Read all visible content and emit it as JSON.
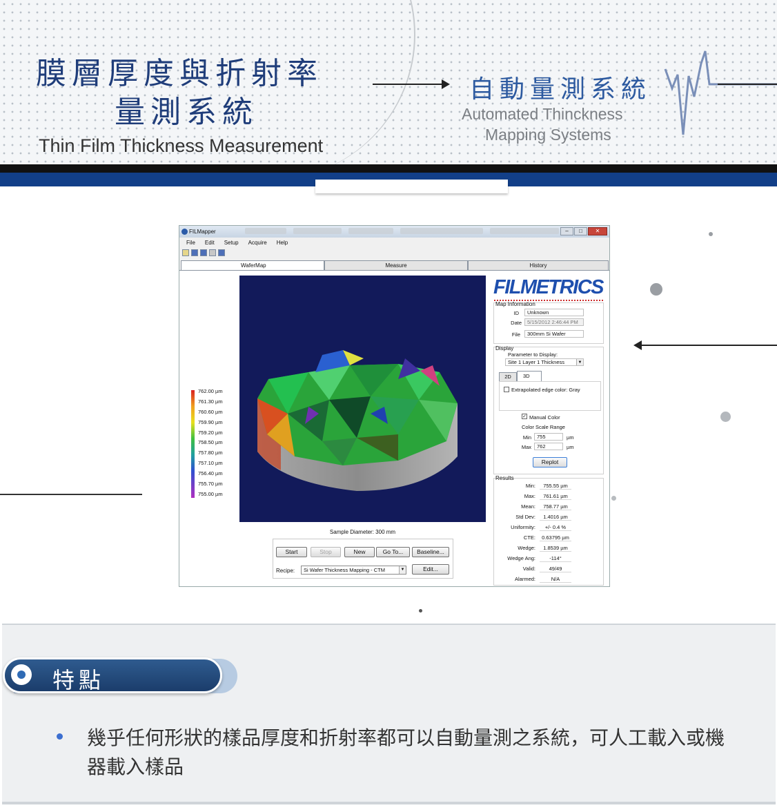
{
  "header": {
    "title_cn_line1": "膜層厚度與折射率",
    "title_cn_line2": "量測系統",
    "title_en": "Thin Film Thickness Measurement",
    "subtitle_cn": "自動量測系統",
    "subtitle_en_line1": "Automated Thinckness",
    "subtitle_en_line2": "Mapping Systems"
  },
  "app": {
    "window_title": "FILMapper",
    "window_controls": [
      "–",
      "□",
      "✕"
    ],
    "menu": [
      "File",
      "Edit",
      "Setup",
      "Acquire",
      "Help"
    ],
    "tabs": [
      "WaferMap",
      "Measure",
      "History"
    ],
    "legend_labels": [
      "762.00 µm",
      "761.30 µm",
      "760.60 µm",
      "759.90 µm",
      "759.20 µm",
      "758.50 µm",
      "757.80 µm",
      "757.10 µm",
      "756.40 µm",
      "755.70 µm",
      "755.00 µm"
    ],
    "sample_diameter": "Sample Diameter: 300 mm",
    "buttons": {
      "start": "Start",
      "stop": "Stop",
      "new": "New",
      "goto": "Go To...",
      "baseline": "Baseline...",
      "edit": "Edit...",
      "replot": "Replot"
    },
    "recipe_label": "Recipe:",
    "recipe_value": "Si Wafer Thickness Mapping - CTM",
    "select_arrow": "▼",
    "logo": "FILMETRICS",
    "map_info": {
      "title": "Map Information",
      "id_label": "ID",
      "id_value": "Unknown",
      "date_label": "Date",
      "date_value": "5/15/2012 2:46:44 PM",
      "file_label": "File",
      "file_value": "300mm Si Wafer"
    },
    "display": {
      "title": "Display",
      "param_label": "Parameter to Display:",
      "param_value": "Site 1 Layer 1 Thickness",
      "tab_2d": "2D",
      "tab_3d": "3D",
      "extrapolated_label": "Extrapolated edge color: Gray",
      "manual_color_label": "Manual Color",
      "manual_color_checked": "✓",
      "color_scale_label": "Color Scale Range",
      "min_label": "Min",
      "min_value": "755",
      "min_unit": "µm",
      "max_label": "Max",
      "max_value": "762",
      "max_unit": "µm"
    },
    "results": {
      "title": "Results",
      "rows": [
        {
          "label": "Min:",
          "value": "755.55 µm"
        },
        {
          "label": "Max:",
          "value": "761.61 µm"
        },
        {
          "label": "Mean:",
          "value": "758.77 µm"
        },
        {
          "label": "Std Dev:",
          "value": "1.4016 µm"
        },
        {
          "label": "Uniformity:",
          "value": "+/- 0.4 %"
        },
        {
          "label": "CTE:",
          "value": "0.63795 µm"
        },
        {
          "label": "Wedge:",
          "value": "1.8539 µm"
        },
        {
          "label": "Wedge Ang:",
          "value": "-114°"
        },
        {
          "label": "Valid:",
          "value": "49/49"
        },
        {
          "label": "Alarmed:",
          "value": "N/A"
        }
      ]
    }
  },
  "features": {
    "heading": "特點",
    "items": [
      "幾乎任何形狀的樣品厚度和折射率都可以自動量測之系統，可人工載入或機器載入樣品"
    ]
  },
  "colors": {
    "brand_blue": "#123f88",
    "title_blue": "#1f3d7a",
    "logo_blue": "#1e4fae",
    "map_background": "#121a5a"
  }
}
